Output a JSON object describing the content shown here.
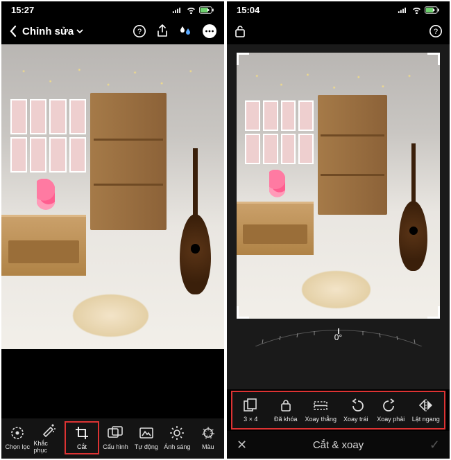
{
  "left": {
    "status": {
      "time": "15:27"
    },
    "header": {
      "title": "Chỉnh sửa"
    },
    "tools": [
      {
        "key": "chon_loc",
        "label": "Chọn lọc"
      },
      {
        "key": "khac_phuc",
        "label": "Khắc phục"
      },
      {
        "key": "cat",
        "label": "Cắt",
        "highlight": true
      },
      {
        "key": "cau_hinh",
        "label": "Cấu hình"
      },
      {
        "key": "tu_dong",
        "label": "Tự động"
      },
      {
        "key": "anh_sang",
        "label": "Ánh sáng"
      },
      {
        "key": "mau",
        "label": "Màu"
      }
    ]
  },
  "right": {
    "status": {
      "time": "15:04"
    },
    "rotation": {
      "angle": "0°"
    },
    "crop_tools": [
      {
        "key": "ratio",
        "label": "3 × 4"
      },
      {
        "key": "lock",
        "label": "Đã khóa"
      },
      {
        "key": "straighten",
        "label": "Xoay thẳng"
      },
      {
        "key": "rotate_left",
        "label": "Xoay trái"
      },
      {
        "key": "rotate_right",
        "label": "Xoay phải"
      },
      {
        "key": "flip_h",
        "label": "Lật ngang"
      }
    ],
    "mode": {
      "title": "Cắt & xoay"
    }
  },
  "colors": {
    "highlight": "#d33333"
  }
}
